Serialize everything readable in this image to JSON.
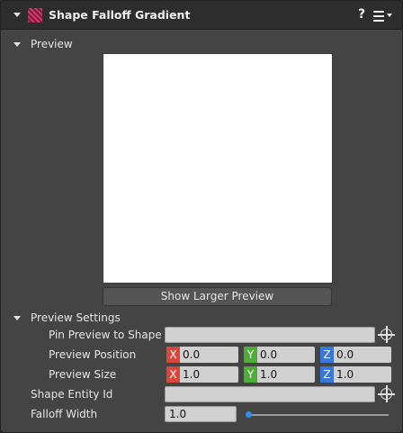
{
  "header": {
    "title": "Shape Falloff Gradient",
    "help_glyph": "?",
    "icon": "shape-falloff-gradient-icon",
    "accent": "#d9366f"
  },
  "preview": {
    "section_label": "Preview",
    "show_larger_label": "Show Larger Preview",
    "preview_color": "#ffffff"
  },
  "preview_settings": {
    "section_label": "Preview Settings",
    "pin_label": "Pin Preview to Shape",
    "pin_value": "",
    "position_label": "Preview Position",
    "position": {
      "x_tag": "X",
      "x": "0.0",
      "y_tag": "Y",
      "y": "0.0",
      "z_tag": "Z",
      "z": "0.0"
    },
    "size_label": "Preview Size",
    "size": {
      "x_tag": "X",
      "x": "1.0",
      "y_tag": "Y",
      "y": "1.0",
      "z_tag": "Z",
      "z": "1.0"
    }
  },
  "shape_entity": {
    "label": "Shape Entity Id",
    "value": ""
  },
  "falloff": {
    "label": "Falloff Width",
    "value": "1.0",
    "slider_fraction": 0.0
  },
  "colors": {
    "x_axis": "#d9473b",
    "y_axis": "#4fae3a",
    "z_axis": "#3a77d6",
    "slider": "#2f8ff0"
  }
}
